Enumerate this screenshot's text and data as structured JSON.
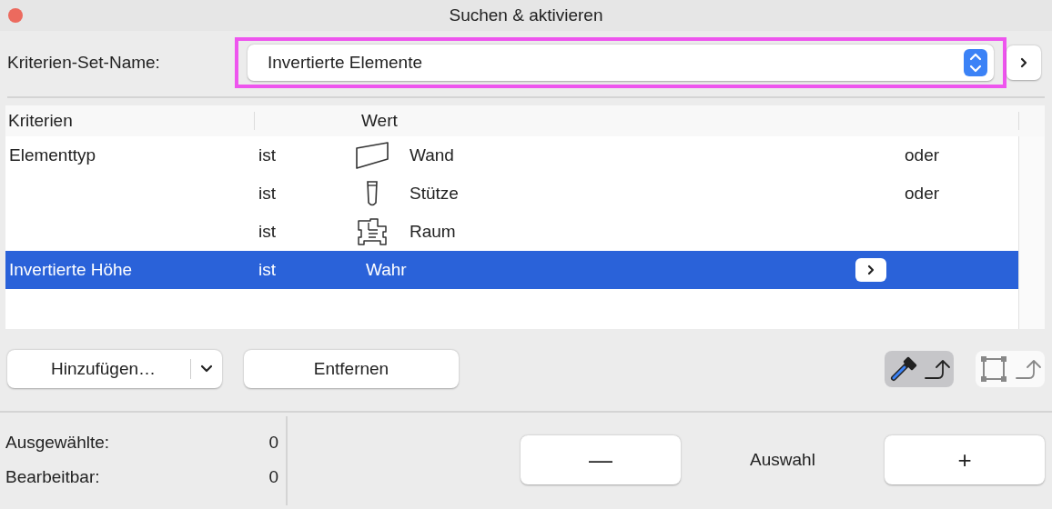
{
  "window": {
    "title": "Suchen & aktivieren"
  },
  "criteria_set": {
    "label": "Kriterien-Set-Name:",
    "value": "Invertierte Elemente",
    "highlighted": true
  },
  "table": {
    "columns": {
      "criterion": "Kriterien",
      "value": "Wert"
    },
    "rows": [
      {
        "criterion": "Elementtyp",
        "operator": "ist",
        "kind": "wall",
        "value": "Wand",
        "conjunction": "oder",
        "selected": false,
        "value_button": false
      },
      {
        "operator": "ist",
        "kind": "column",
        "value": "Stütze",
        "conjunction": "oder",
        "selected": false,
        "value_button": false
      },
      {
        "operator": "ist",
        "kind": "zone",
        "value": "Raum",
        "selected": false,
        "value_button": false
      },
      {
        "criterion": "Invertierte Höhe",
        "operator": "ist",
        "value": "Wahr",
        "selected": true,
        "value_button": true
      }
    ]
  },
  "buttons": {
    "add": "Hinzufügen…",
    "remove": "Entfernen"
  },
  "tools": [
    {
      "kind": "eyedropper",
      "pressed": true
    },
    {
      "kind": "marquee",
      "pressed": false
    }
  ],
  "stats": [
    {
      "label": "Ausgewählte:",
      "value": "0"
    },
    {
      "label": "Bearbeitbar:",
      "value": "0"
    }
  ],
  "selection": {
    "minus": "—",
    "label": "Auswahl",
    "plus": "+"
  }
}
